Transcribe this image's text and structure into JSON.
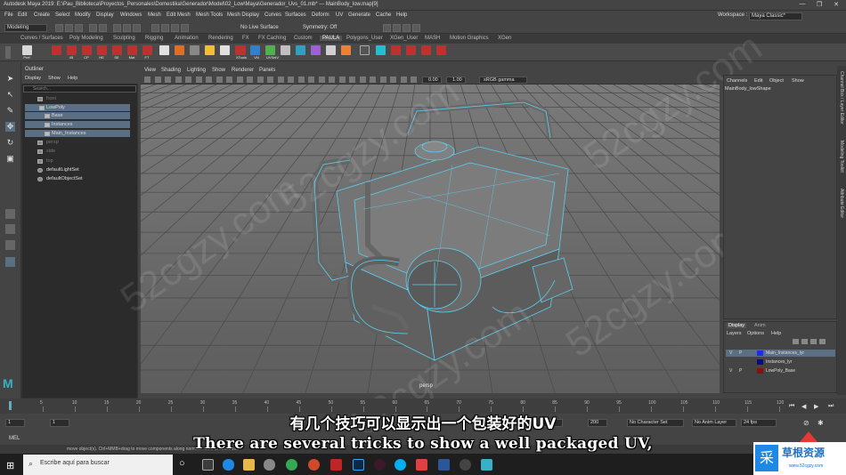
{
  "window": {
    "title": "Autodesk Maya 2019: E:\\Pau_Biblioteca\\Proyectos_Personales\\Domestika\\Generador\\Model\\02_Low\\Maya\\Generador_Uvs_01.mb*   ---   MainBody_low.map[9]",
    "controls": [
      "—",
      "❐",
      "✕"
    ]
  },
  "menubar": {
    "items": [
      "File",
      "Edit",
      "Create",
      "Select",
      "Modify",
      "Display",
      "Windows",
      "Mesh",
      "Edit Mesh",
      "Mesh Tools",
      "Mesh Display",
      "Curves",
      "Surfaces",
      "Deform",
      "UV",
      "Generate",
      "Cache",
      "Help"
    ],
    "workspace_label": "Workspace :",
    "workspace_value": "Maya Classic*"
  },
  "statusline": {
    "mode": "Modeling",
    "live_surface": "No Live Surface",
    "symmetry": "Symmetry: Off"
  },
  "shelf": {
    "tabs": [
      "Curves / Surfaces",
      "Poly Modeling",
      "Sculpting",
      "Rigging",
      "Animation",
      "Rendering",
      "FX",
      "FX Caching",
      "Custom",
      "PAULA",
      "Polygons_User",
      "XGen_User",
      "MASH",
      "Motion Graphics",
      "XGen"
    ],
    "active_tab": "PAULA",
    "icons": [
      "Pref",
      "",
      "45",
      "CP",
      "HE",
      "SE",
      "Mat",
      "FT",
      "",
      "",
      "",
      "",
      "",
      "",
      "",
      "",
      "",
      "",
      "",
      "XTools",
      "VN",
      "UVSelV",
      ""
    ]
  },
  "outliner": {
    "title": "Outliner",
    "menu": [
      "Display",
      "Show",
      "Help"
    ],
    "search_placeholder": "Search...",
    "items": [
      {
        "label": "front",
        "dim": true
      },
      {
        "label": "LowPoly",
        "selected": true
      },
      {
        "label": "Base",
        "selected": true
      },
      {
        "label": "Instances",
        "selected": true
      },
      {
        "label": "Main_Instances",
        "selected": true
      },
      {
        "label": "persp",
        "dim": true
      },
      {
        "label": "side",
        "dim": true
      },
      {
        "label": "top",
        "dim": true
      },
      {
        "label": "defaultLightSet"
      },
      {
        "label": "defaultObjectSet"
      }
    ]
  },
  "viewport": {
    "menu": [
      "View",
      "Shading",
      "Lighting",
      "Show",
      "Renderer",
      "Panels"
    ],
    "field1": "0.00",
    "field2": "1.00",
    "colorspace": "sRGB gamma",
    "camera_label": "persp"
  },
  "channelbox": {
    "menu": [
      "Channels",
      "Edit",
      "Object",
      "Show"
    ],
    "object": "MainBody_lowShape"
  },
  "sidetabs": [
    "Channel Box / Layer Editor",
    "Modeling Toolkit",
    "Attribute Editor"
  ],
  "layers": {
    "tabs": [
      "Display",
      "Anim"
    ],
    "menu": [
      "Layers",
      "Options",
      "Help"
    ],
    "rows": [
      {
        "v": "V",
        "p": "P",
        "name": "Main_Instances_lyr",
        "color": "#1c2cf0",
        "selected": true
      },
      {
        "v": "",
        "p": "",
        "name": "Instances_lyr",
        "color": "#0a0a7a",
        "selected": false
      },
      {
        "v": "V",
        "p": "P",
        "name": "LowPoly_Base",
        "color": "#8a1010",
        "selected": false
      }
    ]
  },
  "timeslider": {
    "ticks": [
      "5",
      "10",
      "15",
      "20",
      "25",
      "30",
      "35",
      "40",
      "45",
      "50",
      "55",
      "60",
      "65",
      "70",
      "75",
      "80",
      "85",
      "90",
      "95",
      "100",
      "105",
      "110",
      "115",
      "120"
    ],
    "current": "1"
  },
  "range": {
    "start": "1",
    "start2": "1",
    "end": "120",
    "end2": "200",
    "character_set": "No Character Set",
    "anim_layer": "No Anim Layer",
    "fps": "24 fps"
  },
  "cmdline": {
    "label": "MEL",
    "help": "move object(s). Ctrl+MMB+drag to move components along normals. Shift to constrain."
  },
  "taskbar": {
    "search_placeholder": "Escribe aquí para buscar"
  },
  "subtitles": {
    "chinese": "有几个技巧可以显示出一个包装好的UV",
    "english": "There are several tricks to show a well packaged UV,"
  },
  "watermark": {
    "text": "52cgzy.com",
    "logo_text": "草根资源",
    "logo_url": "www.52cgzy.com"
  },
  "colors": {
    "wire": "#5ad0f0",
    "selection": "#5a6f84",
    "maya_accent": "#3ab0c8"
  }
}
